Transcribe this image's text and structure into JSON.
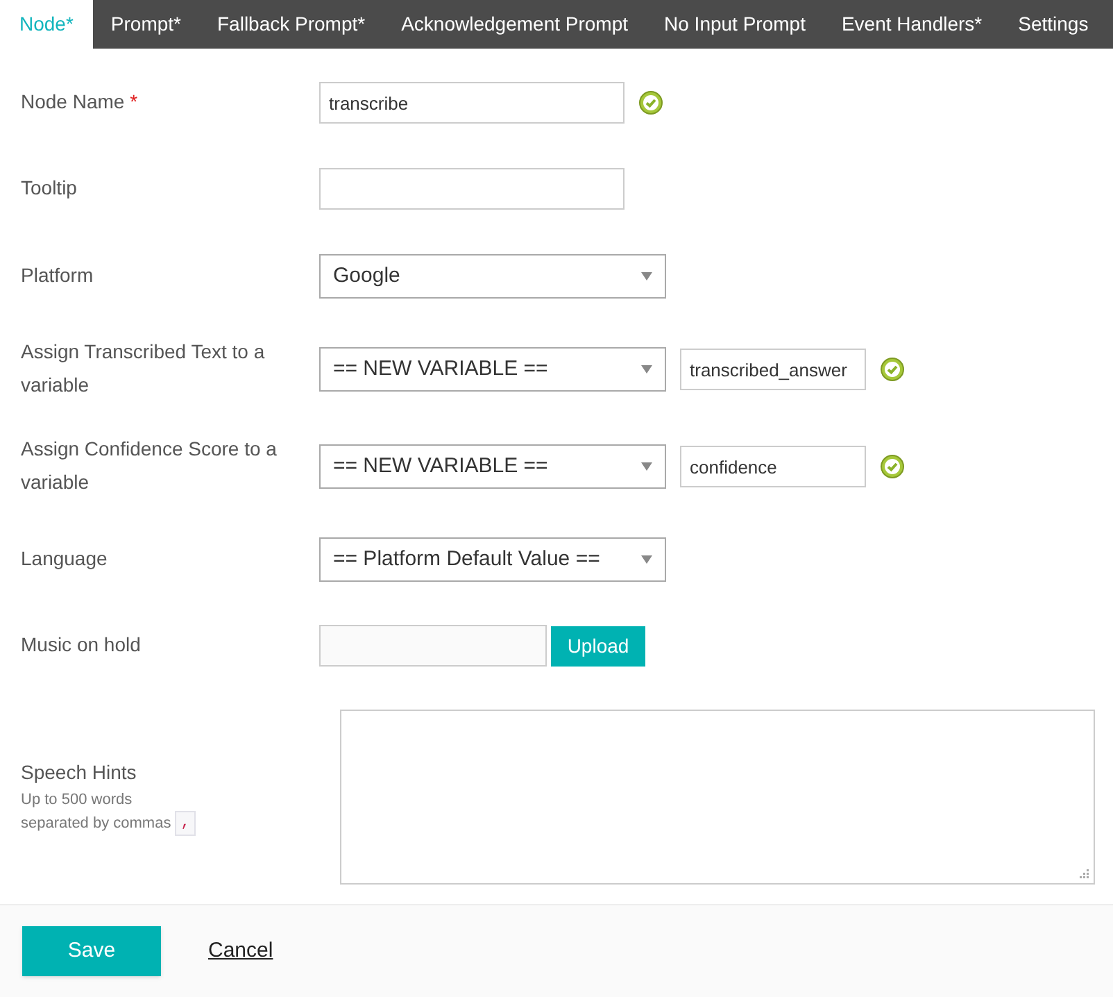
{
  "tabs": [
    {
      "label": "Node*",
      "selected": true
    },
    {
      "label": "Prompt*",
      "selected": false
    },
    {
      "label": "Fallback Prompt*",
      "selected": false
    },
    {
      "label": "Acknowledgement Prompt",
      "selected": false
    },
    {
      "label": "No Input Prompt",
      "selected": false
    },
    {
      "label": "Event Handlers*",
      "selected": false
    },
    {
      "label": "Settings",
      "selected": false
    }
  ],
  "fields": [
    {
      "kind": "text",
      "label": "Node Name",
      "required_mark": "*",
      "value": "transcribe",
      "valid": true
    },
    {
      "kind": "text",
      "label": "Tooltip",
      "valid": false
    },
    {
      "kind": "select",
      "label": "Platform",
      "value": "Google",
      "valid": false
    },
    {
      "kind": "select_text",
      "label": "Assign Transcribed Text to a variable",
      "value": "== NEW VARIABLE ==",
      "text_value": "transcribed_answer",
      "valid": true
    },
    {
      "kind": "select_text",
      "label": "Assign Confidence Score to a variable",
      "value": "== NEW VARIABLE ==",
      "text_value": "confidence",
      "valid": true
    },
    {
      "kind": "select",
      "label": "Language",
      "value": "== Platform Default Value ==",
      "valid": false
    },
    {
      "kind": "file",
      "label": "Music on hold",
      "button": "Upload",
      "valid": false
    },
    {
      "kind": "textarea",
      "label": "Speech Hints",
      "hint_lines": [
        "Up to 500 words",
        "separated by commas"
      ],
      "hint_code": ",",
      "valid": false
    }
  ],
  "footer": {
    "save": "Save",
    "cancel": "Cancel"
  }
}
